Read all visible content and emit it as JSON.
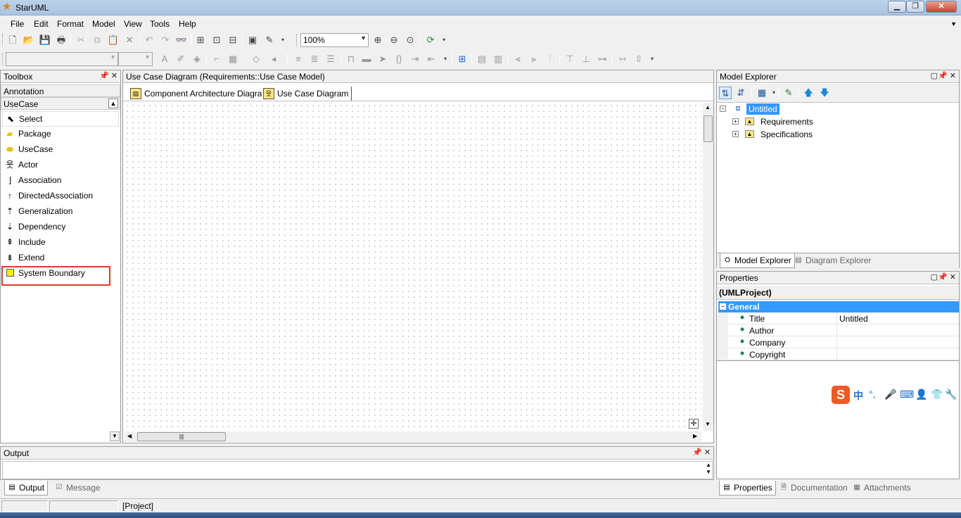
{
  "window": {
    "title": "StarUML",
    "minimize": "▁",
    "maximize": "❐",
    "close": "✕"
  },
  "menu": [
    "File",
    "Edit",
    "Format",
    "Model",
    "View",
    "Tools",
    "Help"
  ],
  "toolbar": {
    "zoom": "100%"
  },
  "toolbox": {
    "header": "Toolbox",
    "annotation": "Annotation",
    "usecase_group": "UseCase",
    "items": [
      {
        "label": "Select",
        "icon": "cursor-icon"
      },
      {
        "label": "Package",
        "icon": "package-icon"
      },
      {
        "label": "UseCase",
        "icon": "usecase-icon"
      },
      {
        "label": "Actor",
        "icon": "actor-icon"
      },
      {
        "label": "Association",
        "icon": "association-icon"
      },
      {
        "label": "DirectedAssociation",
        "icon": "directed-association-icon"
      },
      {
        "label": "Generalization",
        "icon": "generalization-icon"
      },
      {
        "label": "Dependency",
        "icon": "dependency-icon"
      },
      {
        "label": "Include",
        "icon": "include-icon"
      },
      {
        "label": "Extend",
        "icon": "extend-icon"
      },
      {
        "label": "System Boundary",
        "icon": "system-boundary-icon"
      }
    ]
  },
  "diagram": {
    "title": "Use Case Diagram (Requirements::Use Case Model)",
    "tabs": [
      "Component Architecture Diagram",
      "Use Case Diagram"
    ]
  },
  "model_explorer": {
    "header": "Model Explorer",
    "root": "Untitled",
    "children": [
      "Requirements",
      "Specifications"
    ],
    "tabs": [
      "Model Explorer",
      "Diagram Explorer"
    ]
  },
  "properties": {
    "header": "Properties",
    "type": "(UMLProject)",
    "group": "General",
    "rows": [
      {
        "name": "Title",
        "value": "Untitled"
      },
      {
        "name": "Author",
        "value": ""
      },
      {
        "name": "Company",
        "value": ""
      },
      {
        "name": "Copyright",
        "value": ""
      }
    ],
    "tabs": [
      "Properties",
      "Documentation",
      "Attachments"
    ]
  },
  "output": {
    "header": "Output",
    "tabs": [
      "Output",
      "Message"
    ]
  },
  "statusbar": {
    "project": "[Project]"
  },
  "ime": {
    "logo": "S",
    "lang": "中"
  },
  "colors": {
    "selection": "#3399ff",
    "highlight_box": "#e0392d",
    "ime_logo": "#ef5a24"
  }
}
